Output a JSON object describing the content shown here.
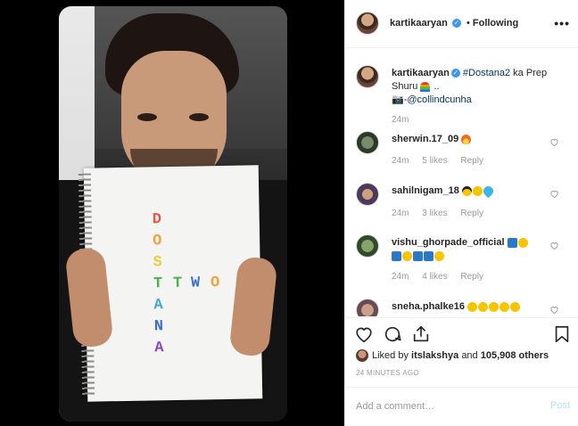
{
  "header": {
    "username": "kartikaaryan",
    "follow_separator": "•",
    "follow_status": "Following",
    "more_icon": "more-horizontal-icon"
  },
  "caption": {
    "username": "kartikaaryan",
    "hashtag": "#Dostana2",
    "text": "ka Prep Shuru",
    "trailing": "..",
    "camera_prefix": "📷-",
    "mention": "@collindcunha",
    "time": "24m"
  },
  "comments": [
    {
      "username": "sherwin.17_09",
      "text": "",
      "emojis": [
        "fire"
      ],
      "time": "24m",
      "likes": "5 likes",
      "reply": "Reply"
    },
    {
      "username": "sahilnigam_18",
      "text": "",
      "emojis": [
        "glass",
        "smile",
        "heartblue"
      ],
      "time": "24m",
      "likes": "3 likes",
      "reply": "Reply"
    },
    {
      "username": "vishu_ghorpade_official",
      "text": "",
      "emojis": [
        "anchor",
        "smile",
        "anchor",
        "smile",
        "anchor",
        "anchor",
        "smile"
      ],
      "time": "24m",
      "likes": "4 likes",
      "reply": "Reply"
    },
    {
      "username": "sneha.phalke16",
      "text": "",
      "emojis": [
        "smile",
        "smile",
        "smile",
        "smile",
        "smile"
      ],
      "time": "",
      "likes": "",
      "reply": ""
    }
  ],
  "likes": {
    "prefix": "Liked by",
    "user": "itslakshya",
    "connector": "and",
    "count": "105,908 others"
  },
  "timestamp": "24 MINUTES AGO",
  "add_comment": {
    "placeholder": "Add a comment…",
    "post_label": "Post"
  },
  "notebook_letters": {
    "vertical": [
      "D",
      "O",
      "S",
      "T",
      "A",
      "N",
      "A"
    ],
    "horizontal": [
      "T",
      "W",
      "O"
    ]
  },
  "colors": {
    "link": "#003569",
    "verified": "#3897f0",
    "muted": "#999999",
    "post_disabled": "#b2dffc"
  }
}
